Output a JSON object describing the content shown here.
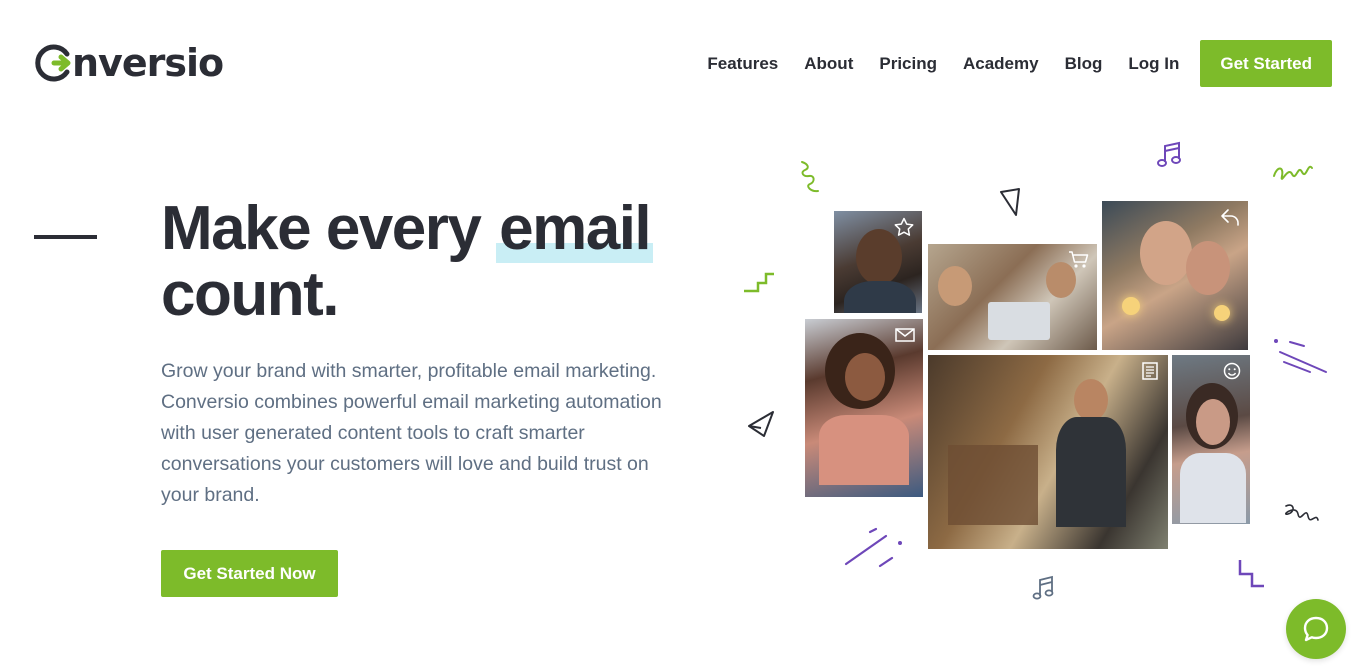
{
  "brand": {
    "logo_text": "nversio",
    "logo_full": "Conversio",
    "accent_color": "#7dbb2a",
    "text_color": "#2b2d35"
  },
  "nav": {
    "items": [
      {
        "label": "Features"
      },
      {
        "label": "About"
      },
      {
        "label": "Pricing"
      },
      {
        "label": "Academy"
      },
      {
        "label": "Blog"
      },
      {
        "label": "Log In"
      }
    ],
    "cta_label": "Get Started"
  },
  "hero": {
    "headline_part1": "Make every ",
    "headline_highlight": "email",
    "headline_part2": "count.",
    "subtext": "Grow your brand with smarter, profitable email marketing. Conversio combines powerful email marketing automation with user generated content tools to craft smarter conversations your customers will love and build trust on your brand.",
    "cta_label": "Get Started Now",
    "highlight_color": "#c9eef5"
  },
  "collage": {
    "photos": [
      {
        "name": "smiling-man",
        "icon": "star-icon"
      },
      {
        "name": "coworkers-laptop",
        "icon": "cart-icon"
      },
      {
        "name": "women-sparklers",
        "icon": "reply-icon"
      },
      {
        "name": "woman-phone",
        "icon": "mail-icon"
      },
      {
        "name": "barista-shop",
        "icon": "receipt-icon"
      },
      {
        "name": "woman-blowing-glitter",
        "icon": "smiley-icon"
      }
    ]
  },
  "chat": {
    "icon": "chat-bubble-icon"
  }
}
